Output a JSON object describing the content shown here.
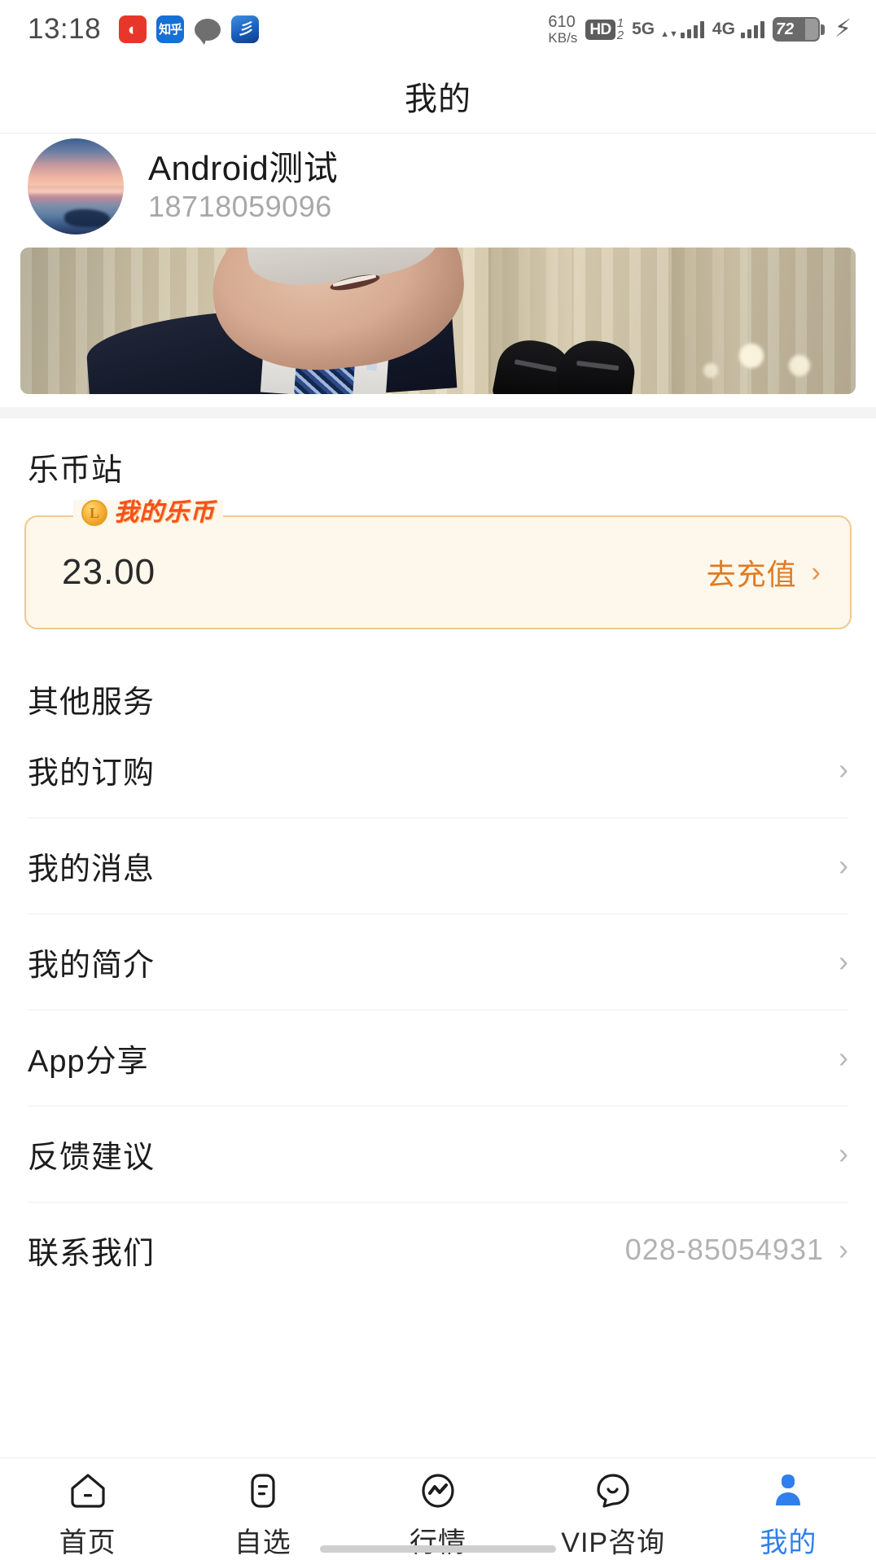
{
  "statusbar": {
    "time": "13:18",
    "app_icons": [
      {
        "name": "netease-music-icon",
        "glyph": "◐"
      },
      {
        "name": "zhihu-icon",
        "glyph": "知乎"
      },
      {
        "name": "message-bubble-icon",
        "glyph": ""
      },
      {
        "name": "blue-app-icon",
        "glyph": "彡"
      }
    ],
    "network_speed_value": "610",
    "network_speed_unit": "KB/s",
    "hd_label": "HD",
    "sim_one": "1",
    "sim_two": "2",
    "signal_primary": "5G",
    "signal_secondary": "4G",
    "battery_level": "72",
    "charging": true
  },
  "header": {
    "title": "我的"
  },
  "profile": {
    "avatar_name": "user-avatar",
    "name": "Android测试",
    "phone": "18718059096"
  },
  "banner": {
    "name": "news-banner",
    "alt": "新闻图片"
  },
  "coin_section": {
    "title": "乐币站",
    "badge_label": "我的乐币",
    "coin_icon_letter": "L",
    "amount": "23.00",
    "action_label": "去充值",
    "chevron": "›"
  },
  "services_section": {
    "title": "其他服务",
    "items": [
      {
        "name": "my-orders",
        "label": "我的订购",
        "value": "",
        "chevron": "›"
      },
      {
        "name": "my-messages",
        "label": "我的消息",
        "value": "",
        "chevron": "›"
      },
      {
        "name": "my-profile",
        "label": "我的简介",
        "value": "",
        "chevron": "›"
      },
      {
        "name": "app-share",
        "label": "App分享",
        "value": "",
        "chevron": "›"
      },
      {
        "name": "feedback",
        "label": "反馈建议",
        "value": "",
        "chevron": "›"
      },
      {
        "name": "contact-us",
        "label": "联系我们",
        "value": "028-85054931",
        "chevron": "›"
      }
    ]
  },
  "tabbar": {
    "items": [
      {
        "name": "tab-home",
        "label": "首页",
        "icon": "house-icon",
        "active": false
      },
      {
        "name": "tab-watchlist",
        "label": "自选",
        "icon": "list-square-icon",
        "active": false
      },
      {
        "name": "tab-quotes",
        "label": "行情",
        "icon": "chart-circle-icon",
        "active": false
      },
      {
        "name": "tab-vip",
        "label": "VIP咨询",
        "icon": "chat-smile-icon",
        "active": false
      },
      {
        "name": "tab-mine",
        "label": "我的",
        "icon": "person-icon",
        "active": true
      }
    ]
  },
  "colors": {
    "accent_blue": "#2f80ed",
    "coin_orange": "#e07b22",
    "badge_red_orange": "#f4511e",
    "card_bg": "#fdf7ec",
    "card_border": "#f0c98c",
    "divider": "#ededed",
    "muted_text": "#b2b2b2"
  }
}
